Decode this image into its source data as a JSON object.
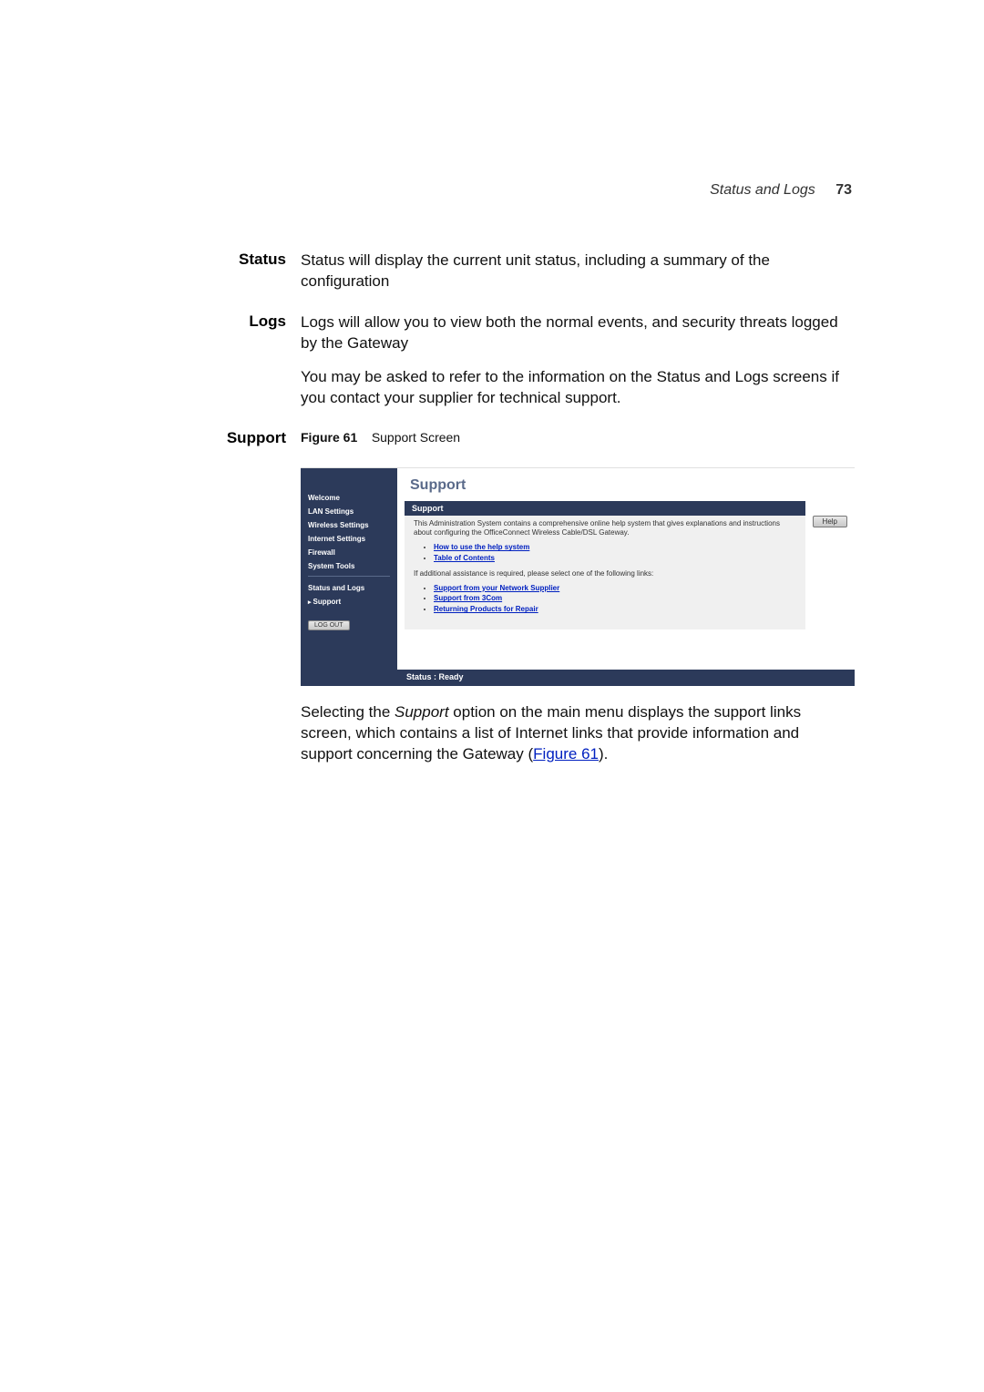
{
  "header": {
    "running_title": "Status and Logs",
    "page_number": "73"
  },
  "sections": {
    "status": {
      "label": "Status",
      "text": "Status will display the current unit status, including a summary of the configuration"
    },
    "logs": {
      "label": "Logs",
      "p1": "Logs will allow you to view both the normal events, and security threats logged by the Gateway",
      "p2": "You may be asked to refer to the information on the Status and Logs screens if you contact your supplier for technical support."
    },
    "support": {
      "label": "Support",
      "figure_label": "Figure 61",
      "figure_title": "Support Screen",
      "post_p1_a": "Selecting the ",
      "post_p1_b": "Support",
      "post_p1_c": " option on the main menu displays the support links screen, which contains a list of Internet links that provide information and support concerning the Gateway (",
      "post_p1_link": "Figure 61",
      "post_p1_d": ")."
    }
  },
  "screenshot": {
    "sidebar": {
      "items": [
        "Welcome",
        "LAN Settings",
        "Wireless Settings",
        "Internet Settings",
        "Firewall",
        "System Tools"
      ],
      "items2": [
        "Status and Logs",
        "Support"
      ],
      "active_index": 1,
      "logout": "LOG OUT"
    },
    "title": "Support",
    "panel_header": "Support",
    "body_intro": "This Administration System contains a comprehensive online help system that gives explanations and instructions about configuring the OfficeConnect Wireless Cable/DSL Gateway.",
    "help_links": [
      "How to use the help system",
      "Table of Contents"
    ],
    "body_mid": "If additional assistance is required, please select one of the following links:",
    "support_links": [
      "Support from your Network Supplier",
      "Support from 3Com",
      "Returning Products for Repair"
    ],
    "help_button": "Help",
    "statusbar": "Status : Ready"
  }
}
